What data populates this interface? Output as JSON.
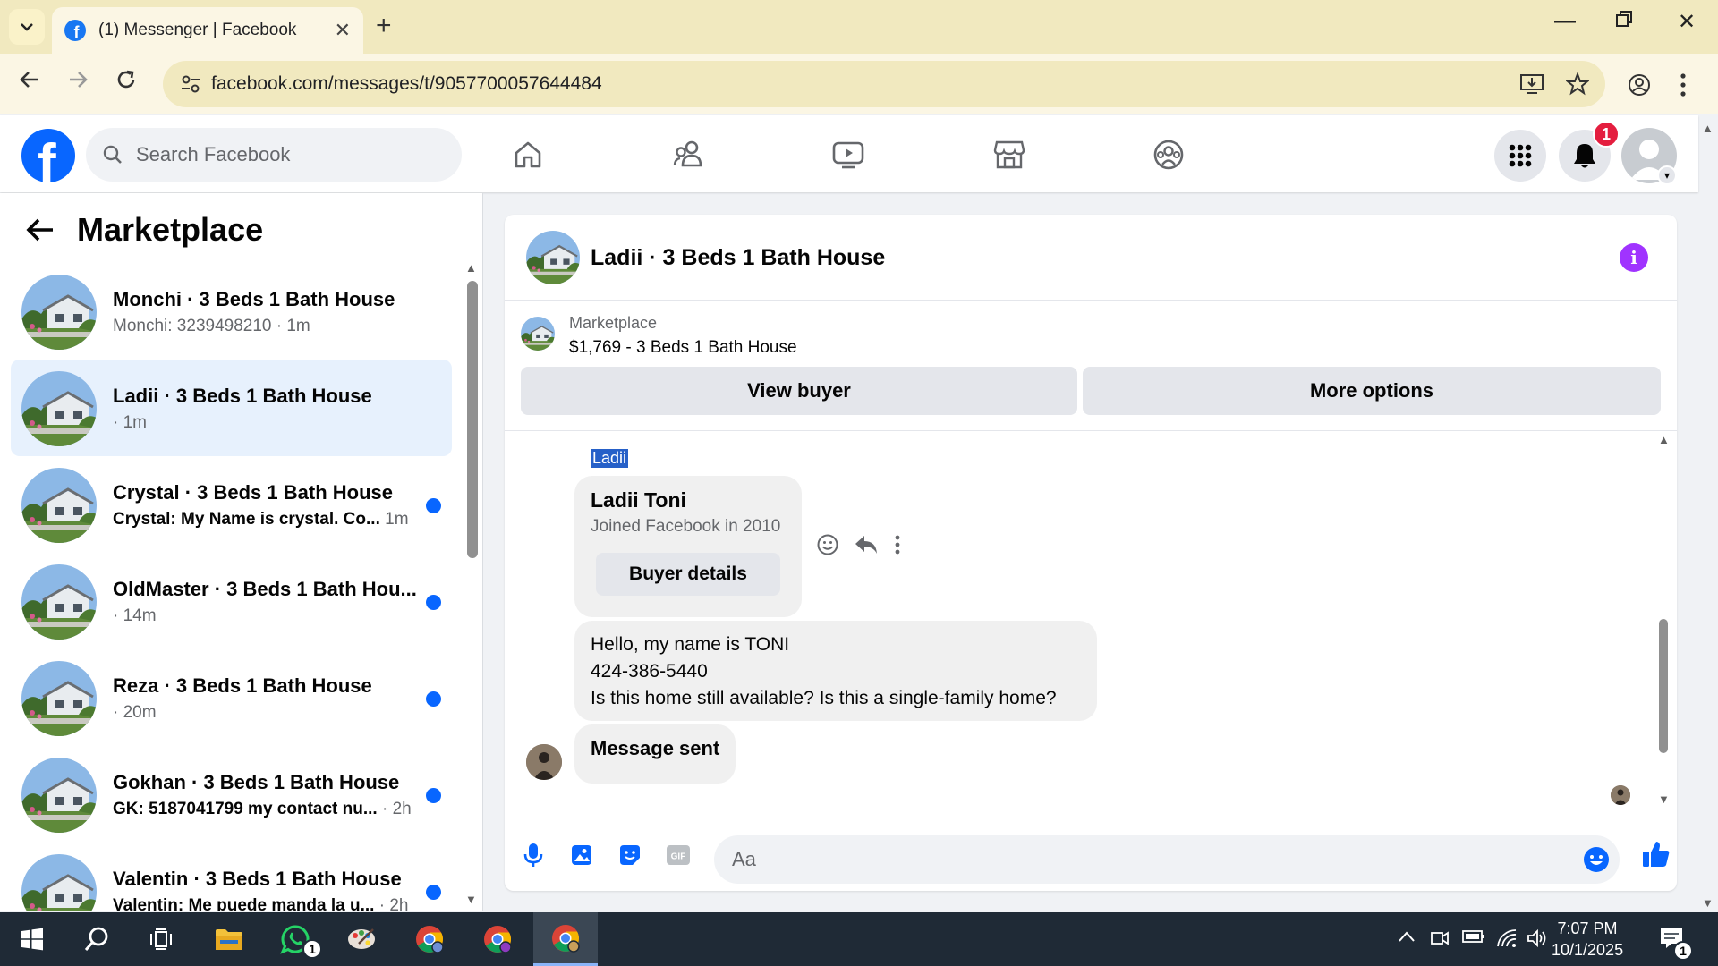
{
  "browser": {
    "tab_title": "(1) Messenger | Facebook",
    "url": "facebook.com/messages/t/9057700057644484"
  },
  "fb": {
    "search_placeholder": "Search Facebook",
    "notification_count": "1"
  },
  "sidebar": {
    "title": "Marketplace",
    "conversations": [
      {
        "name": "Monchi · 3 Beds 1 Bath House",
        "preview": "Monchi: 3239498210",
        "time": " · 1m",
        "unread": false,
        "active": false
      },
      {
        "name": "Ladii · 3 Beds 1 Bath House",
        "preview": "",
        "time": " · 1m",
        "unread": false,
        "active": true
      },
      {
        "name": "Crystal · 3 Beds 1 Bath House",
        "preview": "Crystal: My Name is crystal. Co...",
        "time": " 1m",
        "unread": true,
        "active": false
      },
      {
        "name": "OldMaster · 3 Beds 1 Bath Hou...",
        "preview": "",
        "time": " · 14m",
        "unread": true,
        "active": false
      },
      {
        "name": "Reza · 3 Beds 1 Bath House",
        "preview": "",
        "time": " · 20m",
        "unread": true,
        "active": false
      },
      {
        "name": "Gokhan · 3 Beds 1 Bath House",
        "preview": "GK: 5187041799 my contact nu...",
        "time": " · 2h",
        "unread": true,
        "active": false
      },
      {
        "name": "Valentin · 3 Beds 1 Bath House",
        "preview": "Valentin: Me puede manda la u...",
        "time": " · 2h",
        "unread": true,
        "active": false
      }
    ]
  },
  "chat": {
    "title": "Ladii · 3 Beds 1 Bath House",
    "marketplace_label": "Marketplace",
    "listing": "$1,769 - 3 Beds 1 Bath House",
    "view_buyer": "View buyer",
    "more_options": "More options",
    "sender_name": "Ladii",
    "card_name": "Ladii Toni",
    "card_joined": "Joined Facebook in 2010",
    "card_button": "Buyer details",
    "message_lines": [
      "Hello, my name is TONI",
      "424-386-5440",
      "Is this home still available? Is this a single-family home?"
    ],
    "message_sent": "Message sent",
    "composer_placeholder": "Aa"
  },
  "taskbar": {
    "time": "7:07 PM",
    "date": "10/1/2025",
    "whatsapp_badge": "1",
    "notification_badge": "1"
  },
  "colors": {
    "fb_blue": "#0866ff",
    "active_row": "#e7f1fd",
    "info_purple": "#a033ff",
    "tab_bar": "#f1e9bf",
    "taskbar": "#1f2a36"
  }
}
